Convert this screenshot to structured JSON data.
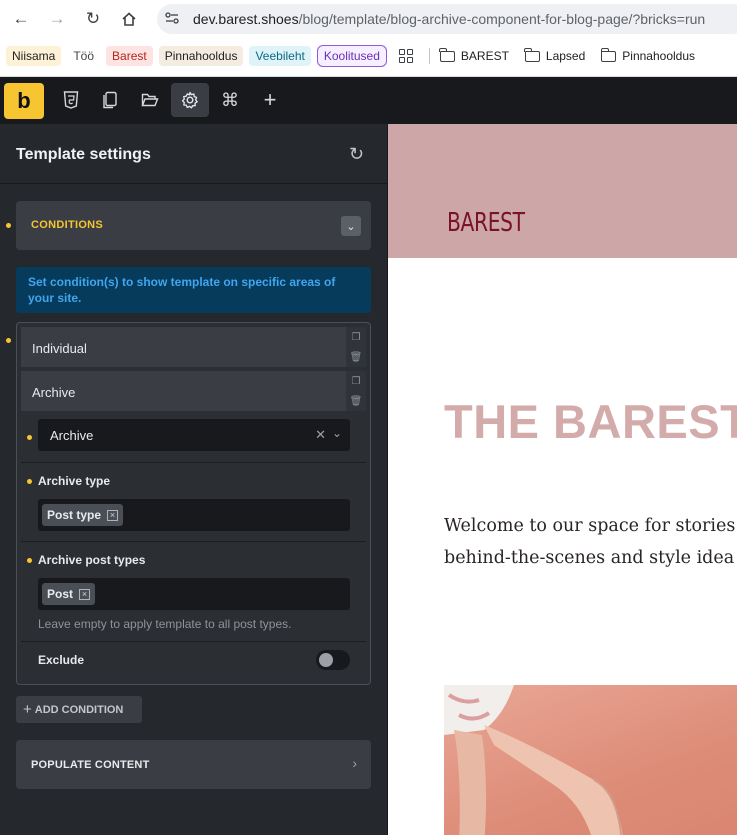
{
  "browser": {
    "url_domain": "dev.barest.shoes",
    "url_path": "/blog/template/blog-archive-component-for-blog-page/?bricks=run",
    "bookmarks": [
      {
        "label": "Niisama"
      },
      {
        "label": "Töö"
      },
      {
        "label": "Barest"
      },
      {
        "label": "Pinnahooldus"
      },
      {
        "label": "Veebileht"
      },
      {
        "label": "Koolitused"
      }
    ],
    "folders": [
      {
        "label": "BAREST"
      },
      {
        "label": "Lapsed"
      },
      {
        "label": "Pinnahooldus"
      }
    ]
  },
  "toolbar": {
    "logo": "b"
  },
  "sidebar": {
    "title": "Template settings",
    "conditions_label": "CONDITIONS",
    "info": "Set condition(s) to show template on specific areas of your site.",
    "conditions": [
      {
        "label": "Individual"
      },
      {
        "label": "Archive"
      }
    ],
    "archive_select_value": "Archive",
    "archive_type_label": "Archive type",
    "archive_type_tag": "Post type",
    "archive_post_types_label": "Archive post types",
    "archive_post_types_tag": "Post",
    "archive_post_types_help": "Leave empty to apply template to all post types.",
    "exclude_label": "Exclude",
    "exclude_on": false,
    "add_condition_label": "ADD CONDITION",
    "populate_content_label": "POPULATE CONTENT"
  },
  "preview": {
    "logo": "BAREST",
    "hero_title": "THE BAREST",
    "intro_line1": "Welcome to our space for stories",
    "intro_line2": "behind-the-scenes and style idea"
  },
  "colors": {
    "accent": "#f7c531",
    "header_bg": "#cda7a8",
    "logo_color": "#7a1229",
    "title_color": "#d4abab"
  }
}
